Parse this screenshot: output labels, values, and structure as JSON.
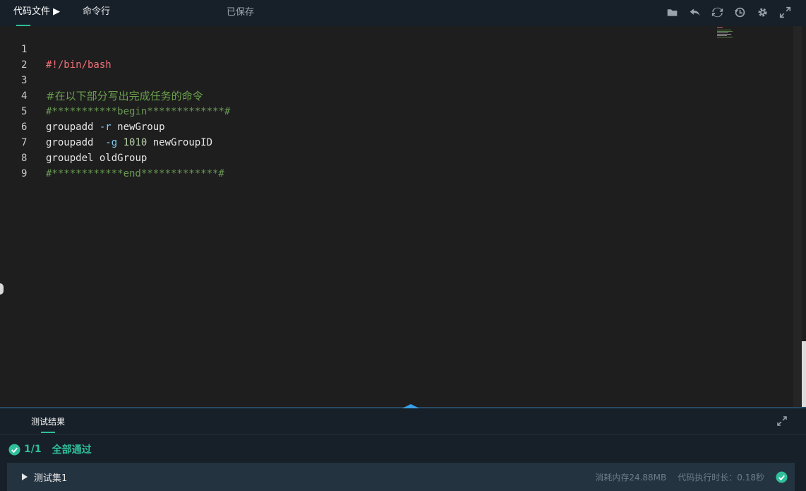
{
  "toolbar": {
    "tab_files": "代码文件 ▶",
    "tab_command": "命令行",
    "status": "已保存",
    "tools": [
      "folder-icon",
      "undo-icon",
      "refresh-icon",
      "history-icon",
      "settings-icon",
      "fullscreen-icon"
    ]
  },
  "editor": {
    "lines": [
      {
        "num": "1",
        "text": "#!/bin/bash"
      },
      {
        "num": "2",
        "text": ""
      },
      {
        "num": "3",
        "text": "#在以下部分写出完成任务的命令"
      },
      {
        "num": "4",
        "text": "#***********begin*************#"
      },
      {
        "num": "5",
        "cmd": "groupadd",
        "flag": " -r",
        "rest": " newGroup"
      },
      {
        "num": "6",
        "cmd": "groupadd",
        "flag": "  -g",
        "numval": " 1010",
        "rest": " newGroupID"
      },
      {
        "num": "7",
        "cmd": "groupdel",
        "rest": " oldGroup"
      },
      {
        "num": "8",
        "text": "#************end*************#"
      },
      {
        "num": "9",
        "text": ""
      }
    ]
  },
  "results": {
    "tab_label": "测试结果",
    "score": "1/1",
    "status": "全部通过",
    "testset_name": "测试集1",
    "memory": "消耗内存24.88MB",
    "runtime": "代码执行时长：0.18秒"
  },
  "colors": {
    "accent": "#2fbf9a",
    "panel_bg": "#172029",
    "editor_bg": "#1e1e1e"
  }
}
